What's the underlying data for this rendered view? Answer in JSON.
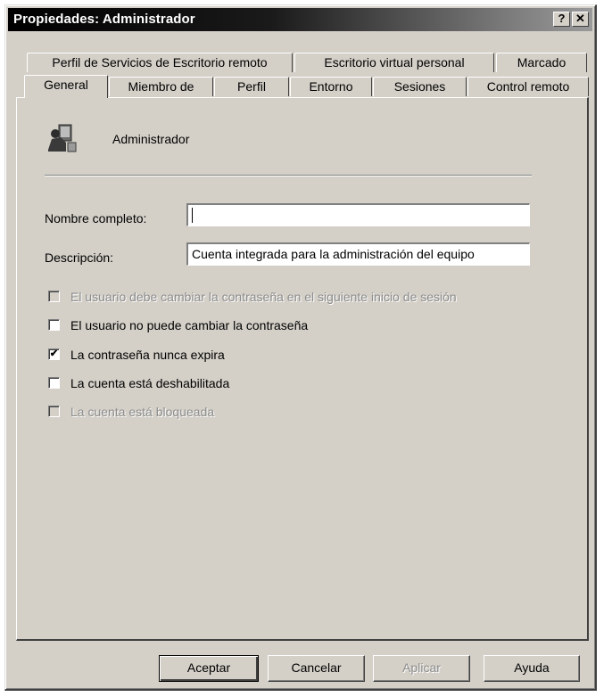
{
  "window": {
    "title": "Propiedades: Administrador"
  },
  "titlebar_buttons": {
    "help": "?",
    "close": "✕"
  },
  "tabs_row1": [
    {
      "label": "Perfil de Servicios de Escritorio remoto"
    },
    {
      "label": "Escritorio virtual personal"
    },
    {
      "label": "Marcado"
    }
  ],
  "tabs_row2": [
    {
      "label": "General",
      "active": true
    },
    {
      "label": "Miembro de"
    },
    {
      "label": "Perfil"
    },
    {
      "label": "Entorno"
    },
    {
      "label": "Sesiones"
    },
    {
      "label": "Control remoto"
    }
  ],
  "general": {
    "user_name": "Administrador",
    "user_icon": "user-computer-icon",
    "full_name_label": "Nombre completo:",
    "full_name_value": "",
    "description_label": "Descripción:",
    "description_value": "Cuenta integrada para la administración del equipo",
    "checkboxes": [
      {
        "label": "El usuario debe cambiar la contraseña en el siguiente inicio de sesión",
        "checked": false,
        "enabled": false
      },
      {
        "label": "El usuario no puede cambiar la contraseña",
        "checked": false,
        "enabled": true
      },
      {
        "label": "La contraseña nunca expira",
        "checked": true,
        "enabled": true
      },
      {
        "label": "La cuenta está deshabilitada",
        "checked": false,
        "enabled": true
      },
      {
        "label": "La cuenta está bloqueada",
        "checked": false,
        "enabled": false
      }
    ]
  },
  "buttons": {
    "ok": "Aceptar",
    "cancel": "Cancelar",
    "apply": "Aplicar",
    "help": "Ayuda"
  },
  "colors": {
    "face": "#d4d0c8",
    "title_start": "#000000",
    "title_end": "#9a9a9a",
    "disabled_text": "#8c8c8c"
  }
}
